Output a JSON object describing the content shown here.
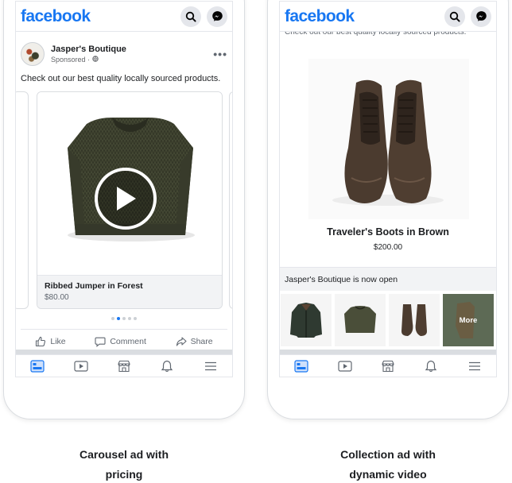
{
  "left_phone": {
    "logo": "facebook",
    "post": {
      "page_name": "Jasper's Boutique",
      "sponsored": "Sponsored · ",
      "text": "Check out our best quality locally sourced products.",
      "card": {
        "title": "Ribbed Jumper in Forest",
        "price": "$80.00"
      },
      "pager": {
        "count": 5,
        "active_index": 1
      },
      "actions": {
        "like": "Like",
        "comment": "Comment",
        "share": "Share"
      }
    },
    "caption_line1": "Carousel ad with",
    "caption_line2": "pricing"
  },
  "right_phone": {
    "logo": "facebook",
    "cut_text": "Check out our best quality locally sourced products.",
    "product": {
      "title": "Traveler's Boots in Brown",
      "price": "$200.00"
    },
    "strip_text": "Jasper's Boutique is now open",
    "more_label": "More",
    "caption_line1": "Collection ad with",
    "caption_line2": "dynamic video"
  },
  "icons": [
    "search-icon",
    "messenger-icon",
    "more-dots-icon",
    "globe-icon",
    "play-icon",
    "like-icon",
    "comment-icon",
    "share-icon",
    "home-icon",
    "video-icon",
    "marketplace-icon",
    "bell-icon",
    "menu-icon"
  ],
  "colors": {
    "brand": "#1877f2",
    "text": "#1c1e21",
    "muted": "#606770",
    "divider": "#e4e6eb"
  }
}
